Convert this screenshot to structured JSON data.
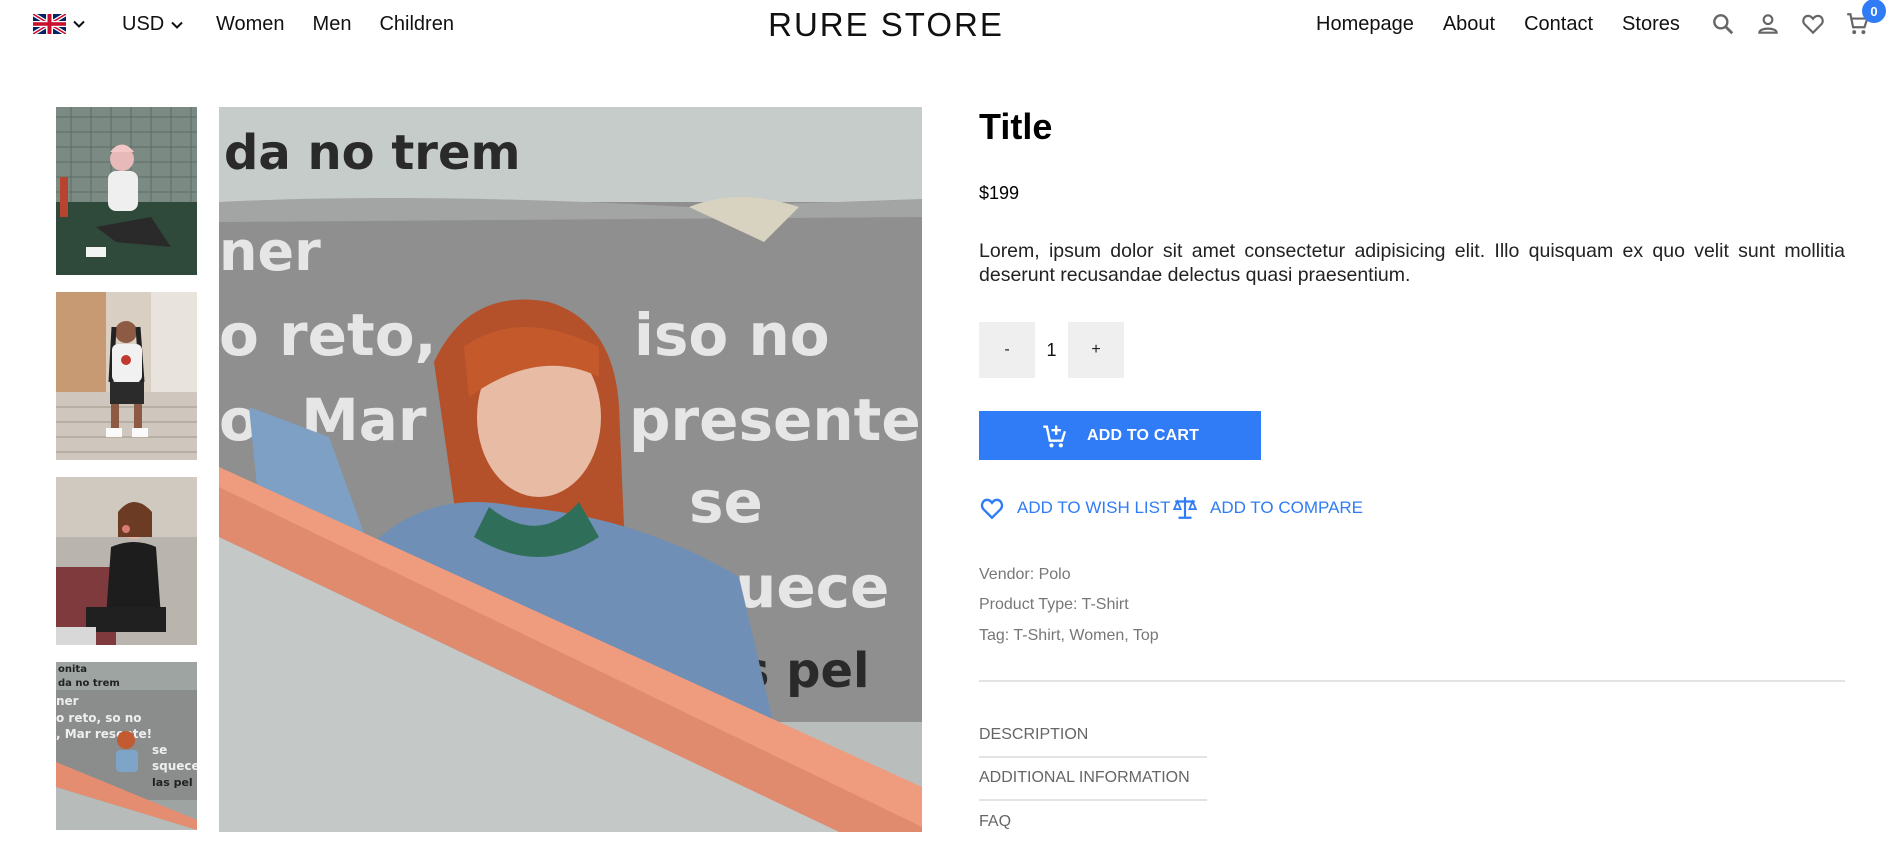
{
  "header": {
    "flag_icon": "uk-flag-icon",
    "currency": "USD",
    "nav_left": [
      "Women",
      "Men",
      "Children"
    ],
    "brand": "RURE STORE",
    "nav_right": [
      "Homepage",
      "About",
      "Contact",
      "Stores"
    ],
    "icons": [
      "search-icon",
      "account-icon",
      "heart-icon",
      "cart-icon"
    ],
    "cart_count": "0"
  },
  "gallery": {
    "thumbnails": [
      "thumbnail-1",
      "thumbnail-2",
      "thumbnail-3",
      "thumbnail-4"
    ],
    "main_image_text": [
      "da no trem",
      "ner",
      "o reto,",
      "iso no",
      "o, Mar",
      "presente!",
      "se",
      "squece",
      "olas pel"
    ]
  },
  "product": {
    "title": "Title",
    "price": "$199",
    "description": "Lorem, ipsum dolor sit amet consectetur adipisicing elit. Illo quisquam ex quo velit sunt mollitia deserunt recusandae delectus quasi praesentium.",
    "quantity": {
      "minus_label": "-",
      "value": "1",
      "plus_label": "+"
    },
    "add_to_cart": "ADD TO CART",
    "add_to_wishlist": "ADD TO WISH LIST",
    "add_to_compare": "ADD TO COMPARE",
    "vendor": "Vendor: Polo",
    "product_type": "Product Type: T-Shirt",
    "tags": "Tag: T-Shirt, Women, Top"
  },
  "accordion": [
    "DESCRIPTION",
    "ADDITIONAL INFORMATION",
    "FAQ"
  ],
  "colors": {
    "accent": "#2f7cf6",
    "muted_text": "#777777",
    "button_grey": "#efefef",
    "divider": "#e3e3e3"
  }
}
